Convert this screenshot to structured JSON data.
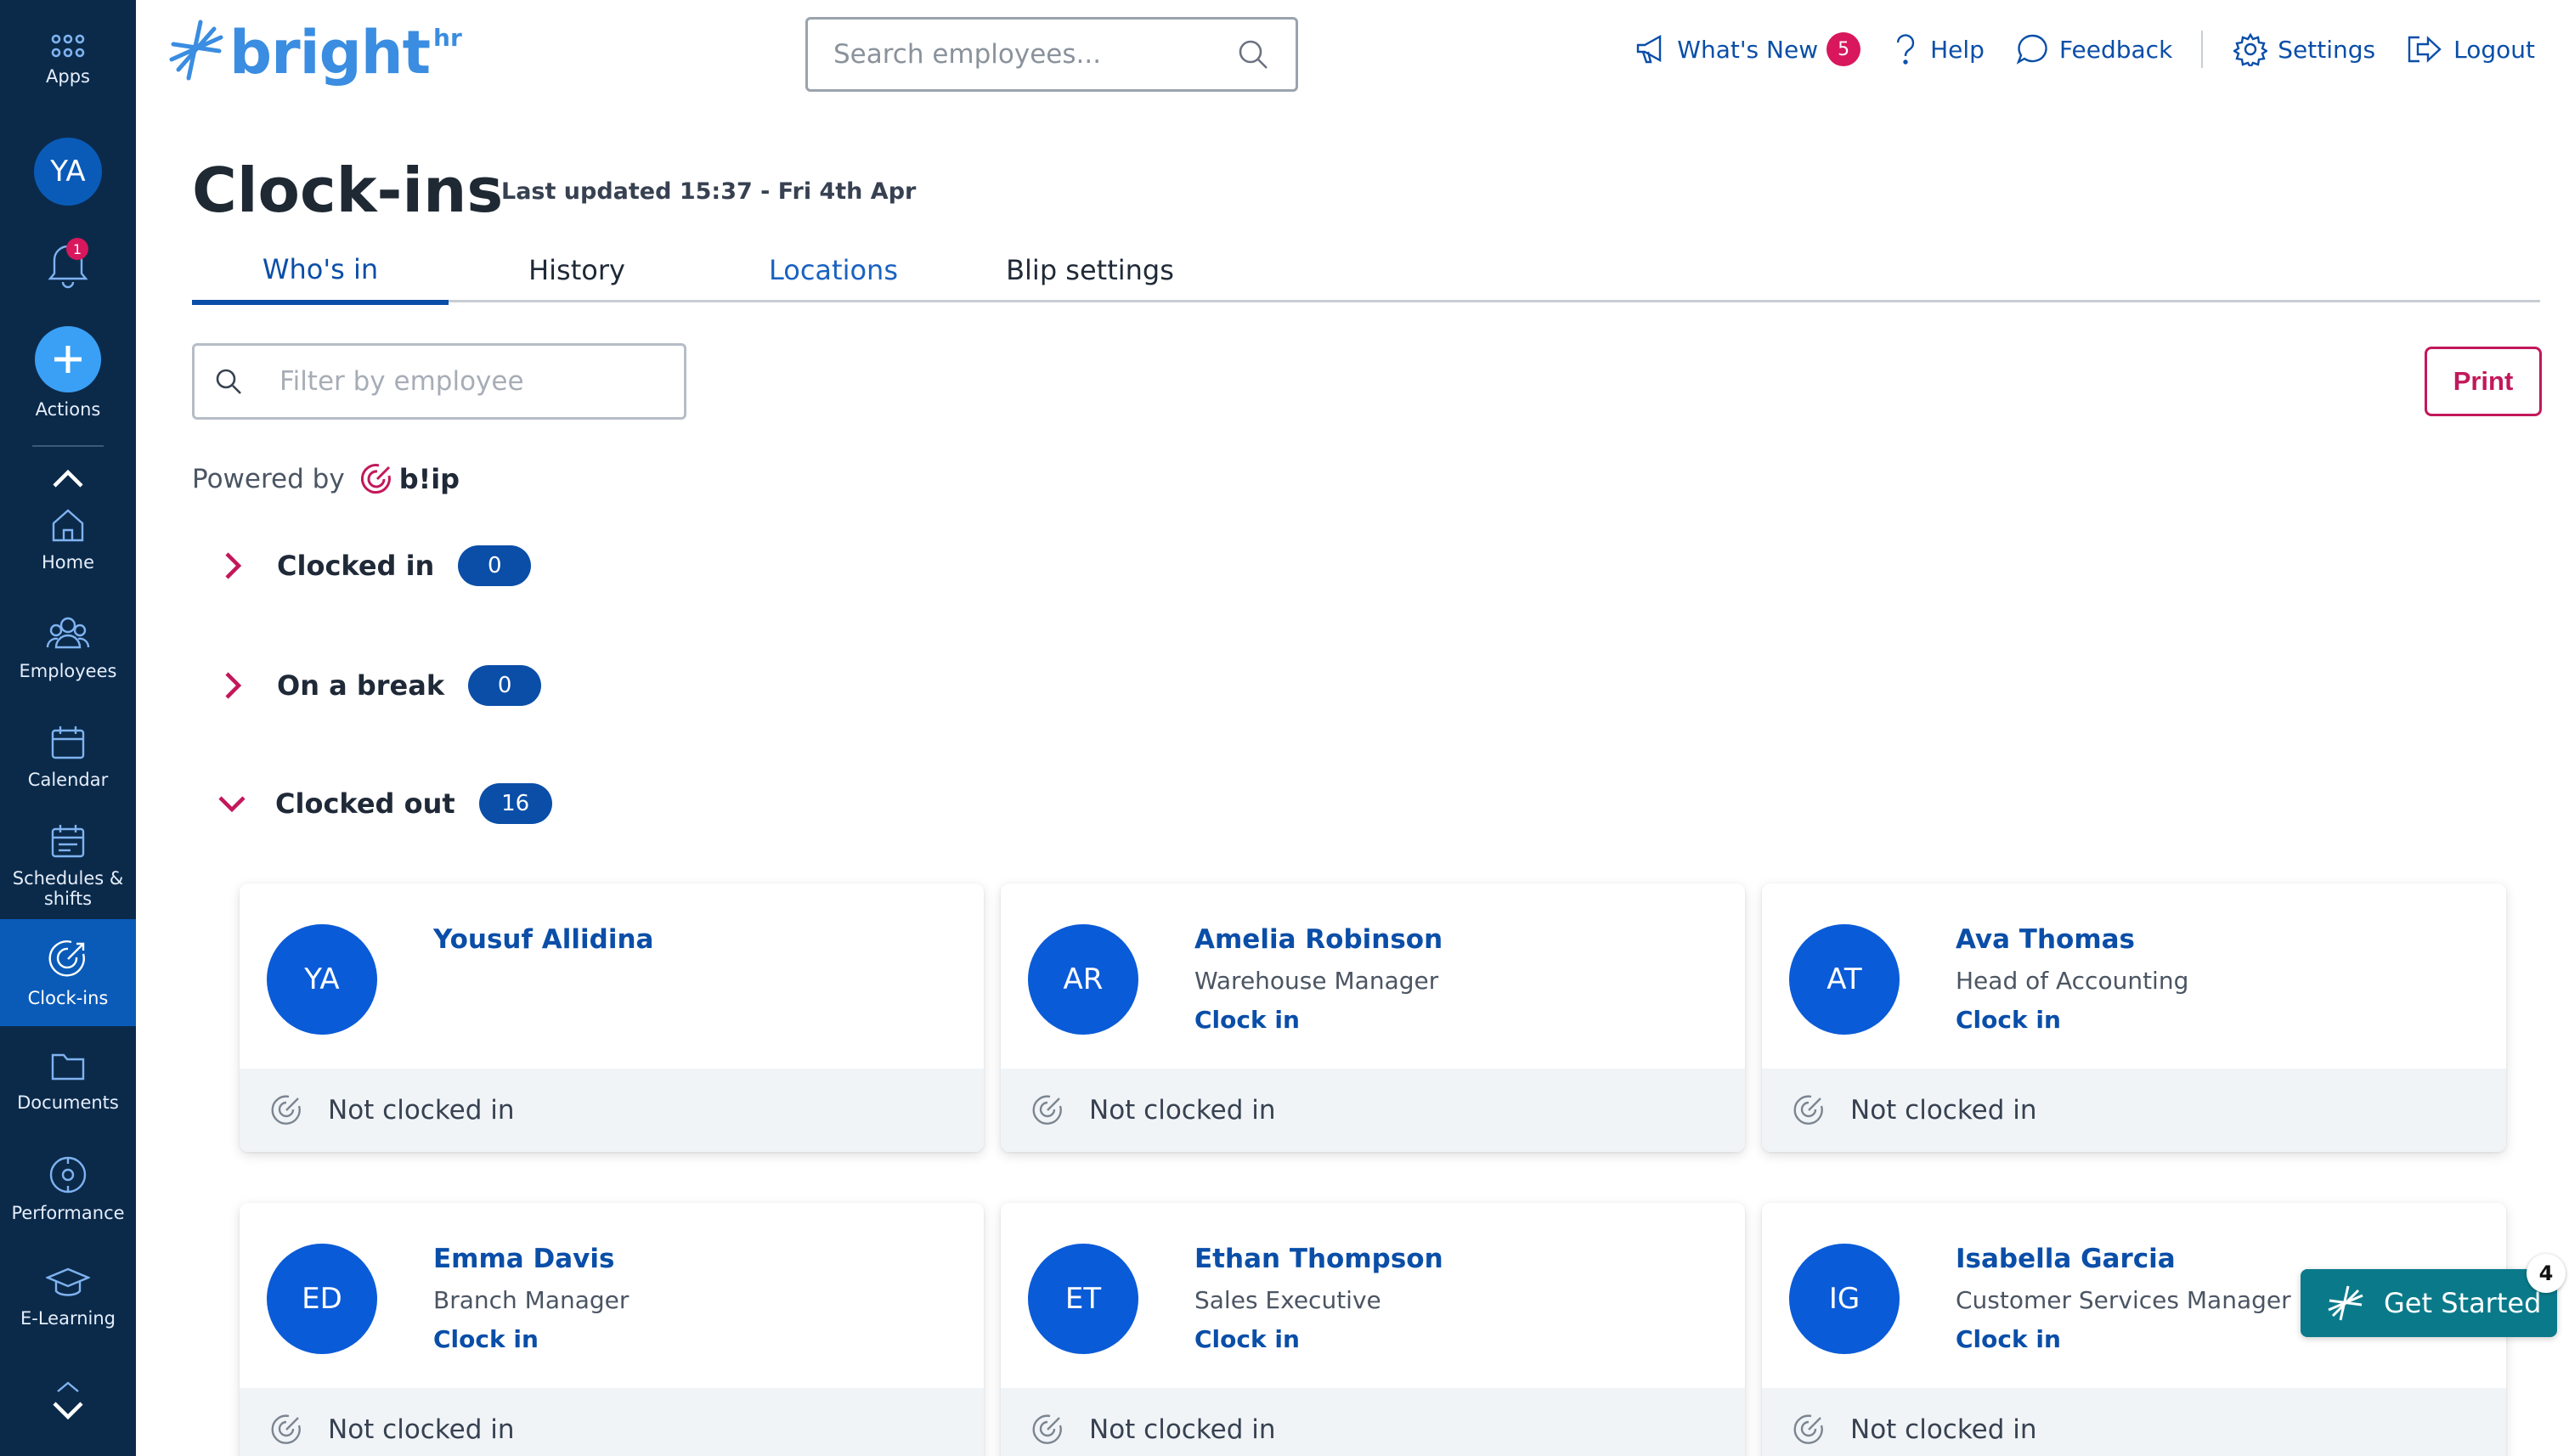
{
  "sidebar": {
    "apps_label": "Apps",
    "user_initials": "YA",
    "notification_count": "1",
    "actions_label": "Actions",
    "items": [
      {
        "label": "Home",
        "icon": "home-icon"
      },
      {
        "label": "Employees",
        "icon": "employees-icon"
      },
      {
        "label": "Calendar",
        "icon": "calendar-icon"
      },
      {
        "label": "Schedules & shifts",
        "icon": "schedules-icon"
      },
      {
        "label": "Clock-ins",
        "icon": "clock-ins-icon",
        "active": true
      },
      {
        "label": "Documents",
        "icon": "folder-icon"
      },
      {
        "label": "Performance",
        "icon": "performance-icon"
      },
      {
        "label": "E-Learning",
        "icon": "graduation-cap-icon"
      }
    ]
  },
  "header": {
    "brand": "bright",
    "brand_suffix": "hr",
    "search_placeholder": "Search employees...",
    "links": {
      "whats_new": "What's New",
      "whats_new_count": "5",
      "help": "Help",
      "feedback": "Feedback",
      "settings": "Settings",
      "logout": "Logout"
    }
  },
  "page": {
    "title": "Clock-ins",
    "last_updated": "Last updated 15:37 - Fri 4th Apr",
    "tabs": [
      "Who's in",
      "History",
      "Locations",
      "Blip settings"
    ],
    "active_tab": "Who's in",
    "filter_placeholder": "Filter by employee",
    "print_label": "Print",
    "powered_by": "Powered by",
    "powered_brand": "b!ip"
  },
  "groups": [
    {
      "name": "Clocked in",
      "count": "0",
      "expanded": false
    },
    {
      "name": "On a break",
      "count": "0",
      "expanded": false
    },
    {
      "name": "Clocked out",
      "count": "16",
      "expanded": true
    }
  ],
  "employees": [
    {
      "initials": "YA",
      "name": "Yousuf Allidina",
      "role": "",
      "action": "",
      "status": "Not clocked in"
    },
    {
      "initials": "AR",
      "name": "Amelia Robinson",
      "role": "Warehouse Manager",
      "action": "Clock in",
      "status": "Not clocked in"
    },
    {
      "initials": "AT",
      "name": "Ava Thomas",
      "role": "Head of Accounting",
      "action": "Clock in",
      "status": "Not clocked in"
    },
    {
      "initials": "ED",
      "name": "Emma Davis",
      "role": "Branch Manager",
      "action": "Clock in",
      "status": "Not clocked in"
    },
    {
      "initials": "ET",
      "name": "Ethan Thompson",
      "role": "Sales Executive",
      "action": "Clock in",
      "status": "Not clocked in"
    },
    {
      "initials": "IG",
      "name": "Isabella Garcia",
      "role": "Customer Services Manager",
      "action": "Clock in",
      "status": "Not clocked in"
    }
  ],
  "get_started": {
    "label": "Get Started",
    "count": "4"
  },
  "colors": {
    "sidebar_bg": "#0b2a4a",
    "primary": "#0a4ea8",
    "accent_pink": "#c2185b",
    "avatar_blue": "#0a5bd8",
    "get_started_bg": "#0a7a8a"
  }
}
